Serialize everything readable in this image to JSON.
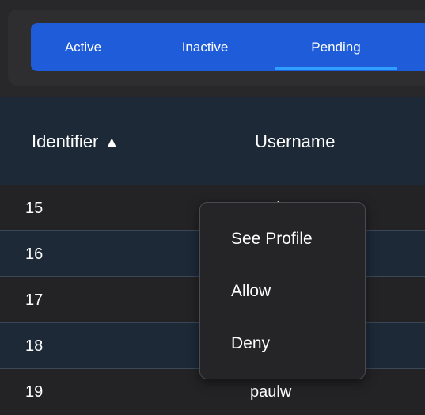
{
  "tabs": [
    {
      "label": "Active"
    },
    {
      "label": "Inactive"
    },
    {
      "label": "Pending",
      "selected": true
    }
  ],
  "table": {
    "headers": {
      "identifier": "Identifier",
      "username": "Username"
    },
    "sort_icon": "▲",
    "rows": [
      {
        "id": "15",
        "username": "pauls"
      },
      {
        "id": "16",
        "username": ""
      },
      {
        "id": "17",
        "username": ""
      },
      {
        "id": "18",
        "username": ""
      },
      {
        "id": "19",
        "username": "paulw"
      }
    ]
  },
  "context_menu": {
    "items": [
      {
        "label": "See Profile"
      },
      {
        "label": "Allow"
      },
      {
        "label": "Deny"
      }
    ]
  },
  "colors": {
    "tab_bar": "#1f5cd9",
    "tab_indicator": "#2fa0ff",
    "header_bg": "#1d2937",
    "page_bg": "#232325"
  }
}
